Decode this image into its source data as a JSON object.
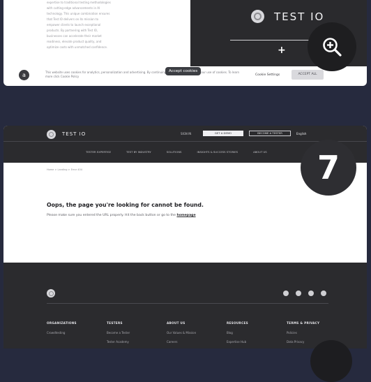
{
  "top_card": {
    "body_lines": [
      "expertise to traditional testing methodologies",
      "with cutting-edge advancements in AI",
      "technology. This unique combination ensures",
      "that Test IO delivers on its mission to",
      "empower clients to launch exceptional",
      "products. By partnering with Test IO,",
      "businesses can accelerate their market",
      "readiness, elevate product quality, and",
      "optimize costs with unmatched confidence."
    ],
    "brand": "TEST IO",
    "plus": "+",
    "cookie_logo": "a",
    "cookie_text": "This website uses cookies for analytics, personalization and advertising. By continuing to browse, you agree to our use of cookies. To learn more click Cookie Policy",
    "tooltip": "Accept cookies",
    "decline": "Cookie Settings",
    "accept": "ACCEPT ALL"
  },
  "header": {
    "brand": "TEST IO",
    "sign_in": "SIGN IN",
    "btn_primary": "GET A DEMO",
    "btn_secondary": "BECOME A TESTER",
    "language": "English",
    "nav": [
      "TESTER EXPERTISE",
      "TEST BY INDUSTRY",
      "SOLUTIONS",
      "INSIGHTS & SUCCESS STORIES",
      "ABOUT US"
    ]
  },
  "badge": "7",
  "breadcrumb": "Home > Landing > Error 404",
  "error": {
    "title": "Oops, the page you're looking for cannot be found.",
    "text": "Please make sure you entered the URL properly. Hit the back button or go to the ",
    "link": "homepage"
  },
  "footer": {
    "columns": [
      {
        "head": "ORGANIZATIONS",
        "links": [
          "Crowdtesting"
        ]
      },
      {
        "head": "TESTERS",
        "links": [
          "Become a Tester",
          "Tester Academy"
        ]
      },
      {
        "head": "ABOUT US",
        "links": [
          "Our Values & Mission",
          "Careers"
        ]
      },
      {
        "head": "RESOURCES",
        "links": [
          "Blog",
          "Expertise Hub"
        ]
      },
      {
        "head": "TERMS & PRIVACY",
        "links": [
          "Policies",
          "Data Privacy"
        ]
      }
    ]
  }
}
